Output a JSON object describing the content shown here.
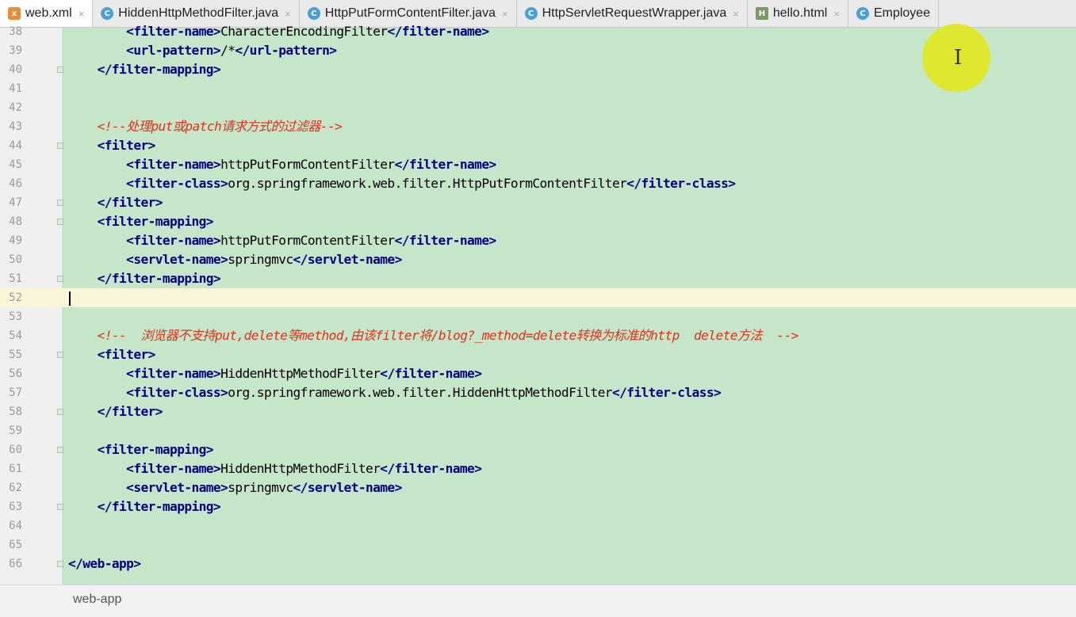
{
  "tabs": [
    {
      "label": "web.xml",
      "icon": "xml-file-icon",
      "active": true
    },
    {
      "label": "HiddenHttpMethodFilter.java",
      "icon": "java-class-icon",
      "active": false
    },
    {
      "label": "HttpPutFormContentFilter.java",
      "icon": "java-class-icon",
      "active": false
    },
    {
      "label": "HttpServletRequestWrapper.java",
      "icon": "java-class-icon",
      "active": false
    },
    {
      "label": "hello.html",
      "icon": "html-file-icon",
      "active": false
    },
    {
      "label": "Employee",
      "icon": "java-class-icon",
      "active": false
    }
  ],
  "editor": {
    "current_line": 52,
    "lines": [
      {
        "n": "38",
        "indent": 8,
        "parts": [
          [
            "tag",
            "<filter-name>"
          ],
          [
            "txt",
            "CharacterEncodingFilter"
          ],
          [
            "tag",
            "</filter-name>"
          ]
        ]
      },
      {
        "n": "39",
        "indent": 8,
        "parts": [
          [
            "tag",
            "<url-pattern>"
          ],
          [
            "txt",
            "/*"
          ],
          [
            "tag",
            "</url-pattern>"
          ]
        ]
      },
      {
        "n": "40",
        "indent": 4,
        "fold": true,
        "parts": [
          [
            "tag",
            "</filter-mapping>"
          ]
        ]
      },
      {
        "n": "41",
        "indent": 0,
        "parts": []
      },
      {
        "n": "42",
        "indent": 0,
        "parts": []
      },
      {
        "n": "43",
        "indent": 4,
        "parts": [
          [
            "cmt",
            "<!--处理put或patch请求方式的过滤器-->"
          ]
        ]
      },
      {
        "n": "44",
        "indent": 4,
        "fold": true,
        "parts": [
          [
            "tag",
            "<filter>"
          ]
        ]
      },
      {
        "n": "45",
        "indent": 8,
        "parts": [
          [
            "tag",
            "<filter-name>"
          ],
          [
            "txt",
            "httpPutFormContentFilter"
          ],
          [
            "tag",
            "</filter-name>"
          ]
        ]
      },
      {
        "n": "46",
        "indent": 8,
        "parts": [
          [
            "tag",
            "<filter-class>"
          ],
          [
            "txt",
            "org.springframework.web.filter.HttpPutFormContentFilter"
          ],
          [
            "tag",
            "</filter-class>"
          ]
        ]
      },
      {
        "n": "47",
        "indent": 4,
        "fold": true,
        "parts": [
          [
            "tag",
            "</filter>"
          ]
        ]
      },
      {
        "n": "48",
        "indent": 4,
        "fold": true,
        "parts": [
          [
            "tag",
            "<filter-mapping>"
          ]
        ]
      },
      {
        "n": "49",
        "indent": 8,
        "parts": [
          [
            "tag",
            "<filter-name>"
          ],
          [
            "txt",
            "httpPutFormContentFilter"
          ],
          [
            "tag",
            "</filter-name>"
          ]
        ]
      },
      {
        "n": "50",
        "indent": 8,
        "parts": [
          [
            "tag",
            "<servlet-name>"
          ],
          [
            "txt",
            "springmvc"
          ],
          [
            "tag",
            "</servlet-name>"
          ]
        ]
      },
      {
        "n": "51",
        "indent": 4,
        "fold": true,
        "parts": [
          [
            "tag",
            "</filter-mapping>"
          ]
        ]
      },
      {
        "n": "52",
        "indent": 0,
        "parts": []
      },
      {
        "n": "53",
        "indent": 0,
        "parts": []
      },
      {
        "n": "54",
        "indent": 4,
        "parts": [
          [
            "cmt",
            "<!--  浏览器不支持put,delete等method,由该filter将/blog?_method=delete转换为标准的http  delete方法  -->"
          ]
        ]
      },
      {
        "n": "55",
        "indent": 4,
        "fold": true,
        "parts": [
          [
            "tag",
            "<filter>"
          ]
        ]
      },
      {
        "n": "56",
        "indent": 8,
        "parts": [
          [
            "tag",
            "<filter-name>"
          ],
          [
            "txt",
            "HiddenHttpMethodFilter"
          ],
          [
            "tag",
            "</filter-name>"
          ]
        ]
      },
      {
        "n": "57",
        "indent": 8,
        "parts": [
          [
            "tag",
            "<filter-class>"
          ],
          [
            "txt",
            "org.springframework.web.filter.HiddenHttpMethodFilter"
          ],
          [
            "tag",
            "</filter-class>"
          ]
        ]
      },
      {
        "n": "58",
        "indent": 4,
        "fold": true,
        "parts": [
          [
            "tag",
            "</filter>"
          ]
        ]
      },
      {
        "n": "59",
        "indent": 0,
        "parts": []
      },
      {
        "n": "60",
        "indent": 4,
        "fold": true,
        "parts": [
          [
            "tag",
            "<filter-mapping>"
          ]
        ]
      },
      {
        "n": "61",
        "indent": 8,
        "parts": [
          [
            "tag",
            "<filter-name>"
          ],
          [
            "txt",
            "HiddenHttpMethodFilter"
          ],
          [
            "tag",
            "</filter-name>"
          ]
        ]
      },
      {
        "n": "62",
        "indent": 8,
        "parts": [
          [
            "tag",
            "<servlet-name>"
          ],
          [
            "txt",
            "springmvc"
          ],
          [
            "tag",
            "</servlet-name>"
          ]
        ]
      },
      {
        "n": "63",
        "indent": 4,
        "fold": true,
        "parts": [
          [
            "tag",
            "</filter-mapping>"
          ]
        ]
      },
      {
        "n": "64",
        "indent": 0,
        "parts": []
      },
      {
        "n": "65",
        "indent": 0,
        "parts": []
      },
      {
        "n": "66",
        "indent": 0,
        "fold": true,
        "parts": [
          [
            "tag",
            "</web-app>"
          ]
        ]
      }
    ]
  },
  "status": {
    "breadcrumb": "web-app"
  },
  "colors": {
    "editor_bg": "#c5e6c8",
    "tag": "#000080",
    "comment": "#e0311d",
    "current_line": "#fbf5d9"
  }
}
